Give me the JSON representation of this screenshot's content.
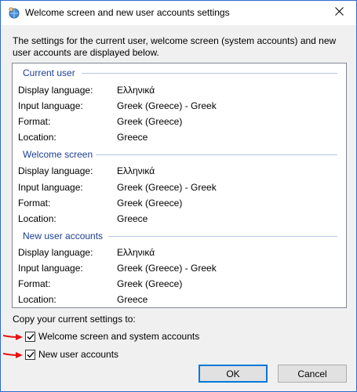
{
  "window": {
    "title": "Welcome screen and new user accounts settings",
    "app_icon": "globe-person-icon",
    "close_icon": "close-icon"
  },
  "intro": "The settings for the current user, welcome screen (system accounts) and new user accounts are displayed below.",
  "sections": [
    {
      "header": "Current user",
      "rows": [
        {
          "label": "Display language:",
          "value": "Ελληνικά"
        },
        {
          "label": "Input language:",
          "value": "Greek (Greece) - Greek"
        },
        {
          "label": "Format:",
          "value": "Greek (Greece)"
        },
        {
          "label": "Location:",
          "value": "Greece"
        }
      ]
    },
    {
      "header": "Welcome screen",
      "rows": [
        {
          "label": "Display language:",
          "value": "Ελληνικά"
        },
        {
          "label": "Input language:",
          "value": "Greek (Greece) - Greek"
        },
        {
          "label": "Format:",
          "value": "Greek (Greece)"
        },
        {
          "label": "Location:",
          "value": "Greece"
        }
      ]
    },
    {
      "header": "New user accounts",
      "rows": [
        {
          "label": "Display language:",
          "value": "Ελληνικά"
        },
        {
          "label": "Input language:",
          "value": "Greek (Greece) - Greek"
        },
        {
          "label": "Format:",
          "value": "Greek (Greece)"
        },
        {
          "label": "Location:",
          "value": "Greece"
        }
      ]
    }
  ],
  "copy": {
    "label": "Copy your current settings to:",
    "options": [
      {
        "label": "Welcome screen and system accounts",
        "checked": true
      },
      {
        "label": "New user accounts",
        "checked": true
      }
    ]
  },
  "buttons": {
    "ok": "OK",
    "cancel": "Cancel"
  },
  "colors": {
    "section_header": "#1c3f94",
    "annotation_arrow": "#e81010",
    "default_button_border": "#0078d7"
  }
}
